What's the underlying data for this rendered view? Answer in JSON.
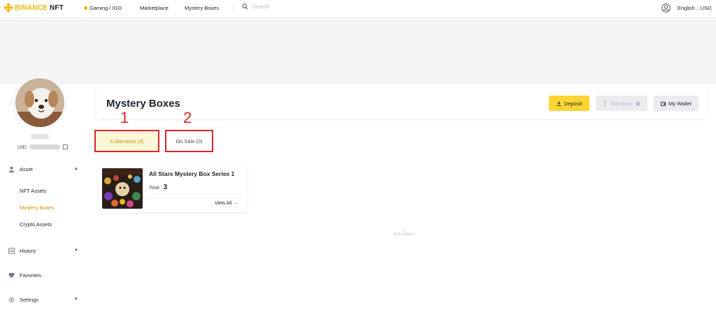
{
  "brand": {
    "name_gold": "BINANCE",
    "name_dark": "NFT",
    "color": "#f0b90b"
  },
  "nav": {
    "items": [
      "Gaming / IGO",
      "Marketplace",
      "Mystery Boxes"
    ],
    "search_placeholder": "Search",
    "language": "English",
    "currency": "USD"
  },
  "profile": {
    "uid_label": "UID"
  },
  "sidebar": {
    "asset": "Asset",
    "asset_children": [
      "NFT Assets",
      "Mystery Boxes",
      "Crypto Assets"
    ],
    "active_child": "Mystery Boxes",
    "history": "History",
    "favorites": "Favorites",
    "settings": "Settings"
  },
  "header": {
    "title": "Mystery Boxes",
    "deposit": "Deposit",
    "withdraw": "Withdraw",
    "wallet": "My Wallet"
  },
  "tabs": [
    {
      "label": "Collections (3)",
      "active": true
    },
    {
      "label": "On Sale (0)",
      "active": false
    }
  ],
  "callouts": [
    "1",
    "2"
  ],
  "collections": [
    {
      "title": "All Stars Mystery Box Series 1",
      "total_label": "Total :",
      "total": "3",
      "view_all": "View All →"
    }
  ],
  "list_end": "At the Bottom",
  "colors": {
    "accent": "#fcd535",
    "active_text": "#c99400",
    "annotation": "#d9262c"
  }
}
